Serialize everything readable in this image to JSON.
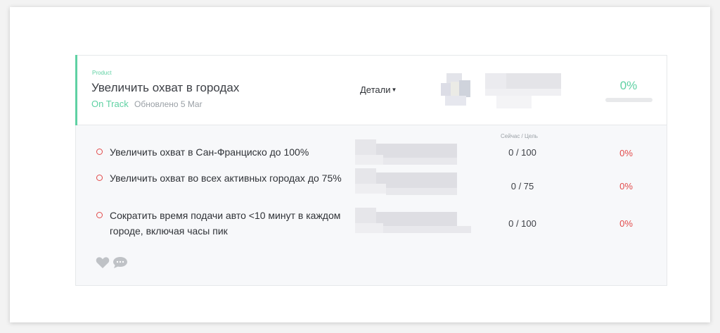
{
  "goal": {
    "category": "Product",
    "title": "Увеличить охват в городах",
    "status": "On Track",
    "updated": "Обновлено 5 Mar",
    "details_label": "Детали",
    "progress_text": "0%",
    "progress_fraction": 0.0
  },
  "key_results_header": "Сейчас / Цель",
  "key_results": [
    {
      "text": "Увеличить охват в Сан-Франциско до 100%",
      "value": "0 / 100",
      "percent": "0%"
    },
    {
      "text": "Увеличить охват во всех активных городах до 75%",
      "value": "0 / 75",
      "percent": "0%"
    },
    {
      "text": "Сократить время подачи авто <10 минут в каждом городе, включая часы пик",
      "value": "0 / 100",
      "percent": "0%"
    }
  ],
  "colors": {
    "accent": "#5fd1a3",
    "negative": "#e24b4b"
  },
  "icons": [
    "heart-icon",
    "comment-icon",
    "chevron-down-icon"
  ]
}
